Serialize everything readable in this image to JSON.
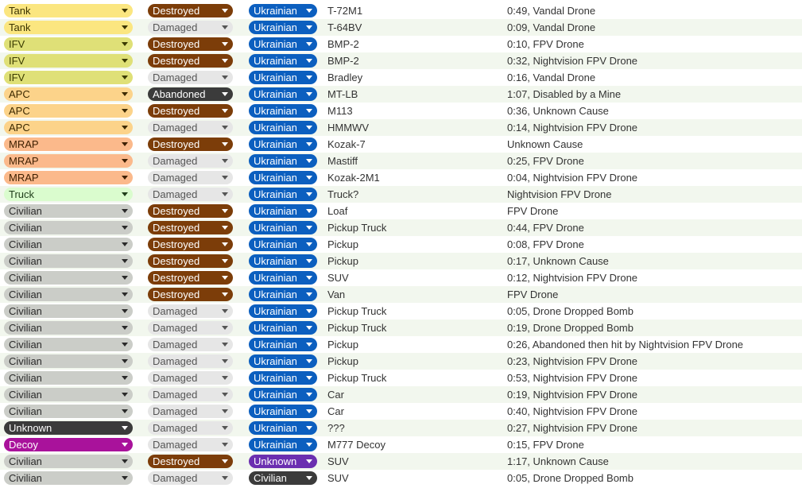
{
  "colors": {
    "type": {
      "Tank": [
        "#fbe680",
        "#3a3300"
      ],
      "IFV": [
        "#dfe077",
        "#3a3a00"
      ],
      "APC": [
        "#fcd38a",
        "#3d2a00"
      ],
      "MRAP": [
        "#fbb98b",
        "#3d1f00"
      ],
      "Truck": [
        "#dafcce",
        "#1f3d1a"
      ],
      "Civilian": [
        "#cbcdc8",
        "#2a2a2a"
      ],
      "Unknown": [
        "#3b3b3b",
        "#ffffff"
      ],
      "Decoy": [
        "#a9129b",
        "#ffffff"
      ]
    },
    "status": {
      "Destroyed": [
        "#7c3d09",
        "#ffffff"
      ],
      "Damaged": [
        "#e6e6e6",
        "#555555"
      ],
      "Abandoned": [
        "#3b3b3b",
        "#ffffff"
      ]
    },
    "owner": {
      "Ukrainian": [
        "#0c5fbf",
        "#ffffff"
      ],
      "Unknown": [
        "#6b2fb0",
        "#ffffff"
      ],
      "Civilian": [
        "#3b3b3b",
        "#ffffff"
      ]
    }
  },
  "rows": [
    {
      "type": "Tank",
      "status": "Destroyed",
      "owner": "Ukrainian",
      "model": "T-72M1",
      "desc": "0:49, Vandal Drone"
    },
    {
      "type": "Tank",
      "status": "Damaged",
      "owner": "Ukrainian",
      "model": "T-64BV",
      "desc": "0:09, Vandal Drone"
    },
    {
      "type": "IFV",
      "status": "Destroyed",
      "owner": "Ukrainian",
      "model": "BMP-2",
      "desc": "0:10, FPV Drone"
    },
    {
      "type": "IFV",
      "status": "Destroyed",
      "owner": "Ukrainian",
      "model": "BMP-2",
      "desc": "0:32, Nightvision FPV Drone"
    },
    {
      "type": "IFV",
      "status": "Damaged",
      "owner": "Ukrainian",
      "model": "Bradley",
      "desc": "0:16, Vandal Drone"
    },
    {
      "type": "APC",
      "status": "Abandoned",
      "owner": "Ukrainian",
      "model": "MT-LB",
      "desc": "1:07, Disabled by a Mine"
    },
    {
      "type": "APC",
      "status": "Destroyed",
      "owner": "Ukrainian",
      "model": "M113",
      "desc": "0:36, Unknown Cause"
    },
    {
      "type": "APC",
      "status": "Damaged",
      "owner": "Ukrainian",
      "model": "HMMWV",
      "desc": "0:14, Nightvision FPV Drone"
    },
    {
      "type": "MRAP",
      "status": "Destroyed",
      "owner": "Ukrainian",
      "model": "Kozak-7",
      "desc": "Unknown Cause"
    },
    {
      "type": "MRAP",
      "status": "Damaged",
      "owner": "Ukrainian",
      "model": "Mastiff",
      "desc": "0:25, FPV Drone"
    },
    {
      "type": "MRAP",
      "status": "Damaged",
      "owner": "Ukrainian",
      "model": "Kozak-2M1",
      "desc": "0:04, Nightvision FPV Drone"
    },
    {
      "type": "Truck",
      "status": "Damaged",
      "owner": "Ukrainian",
      "model": "Truck?",
      "desc": "Nightvision FPV Drone"
    },
    {
      "type": "Civilian",
      "status": "Destroyed",
      "owner": "Ukrainian",
      "model": "Loaf",
      "desc": "FPV Drone"
    },
    {
      "type": "Civilian",
      "status": "Destroyed",
      "owner": "Ukrainian",
      "model": "Pickup Truck",
      "desc": "0:44, FPV Drone"
    },
    {
      "type": "Civilian",
      "status": "Destroyed",
      "owner": "Ukrainian",
      "model": "Pickup",
      "desc": "0:08, FPV Drone"
    },
    {
      "type": "Civilian",
      "status": "Destroyed",
      "owner": "Ukrainian",
      "model": "Pickup",
      "desc": "0:17, Unknown Cause"
    },
    {
      "type": "Civilian",
      "status": "Destroyed",
      "owner": "Ukrainian",
      "model": "SUV",
      "desc": "0:12, Nightvision FPV Drone"
    },
    {
      "type": "Civilian",
      "status": "Destroyed",
      "owner": "Ukrainian",
      "model": "Van",
      "desc": "FPV Drone"
    },
    {
      "type": "Civilian",
      "status": "Damaged",
      "owner": "Ukrainian",
      "model": "Pickup Truck",
      "desc": "0:05, Drone Dropped Bomb"
    },
    {
      "type": "Civilian",
      "status": "Damaged",
      "owner": "Ukrainian",
      "model": "Pickup Truck",
      "desc": "0:19, Drone Dropped Bomb"
    },
    {
      "type": "Civilian",
      "status": "Damaged",
      "owner": "Ukrainian",
      "model": "Pickup",
      "desc": "0:26, Abandoned then hit by Nightvision FPV Drone"
    },
    {
      "type": "Civilian",
      "status": "Damaged",
      "owner": "Ukrainian",
      "model": "Pickup",
      "desc": "0:23, Nightvision FPV Drone"
    },
    {
      "type": "Civilian",
      "status": "Damaged",
      "owner": "Ukrainian",
      "model": "Pickup Truck",
      "desc": "0:53, Nightvision FPV Drone"
    },
    {
      "type": "Civilian",
      "status": "Damaged",
      "owner": "Ukrainian",
      "model": "Car",
      "desc": "0:19, Nightvision FPV Drone"
    },
    {
      "type": "Civilian",
      "status": "Damaged",
      "owner": "Ukrainian",
      "model": "Car",
      "desc": "0:40, Nightvision FPV Drone"
    },
    {
      "type": "Unknown",
      "status": "Damaged",
      "owner": "Ukrainian",
      "model": "???",
      "desc": "0:27, Nightvision FPV Drone"
    },
    {
      "type": "Decoy",
      "status": "Damaged",
      "owner": "Ukrainian",
      "model": "M777 Decoy",
      "desc": "0:15, FPV Drone"
    },
    {
      "type": "Civilian",
      "status": "Destroyed",
      "owner": "Unknown",
      "model": "SUV",
      "desc": "1:17, Unknown Cause"
    },
    {
      "type": "Civilian",
      "status": "Damaged",
      "owner": "Civilian",
      "model": "SUV",
      "desc": "0:05, Drone Dropped Bomb"
    }
  ]
}
